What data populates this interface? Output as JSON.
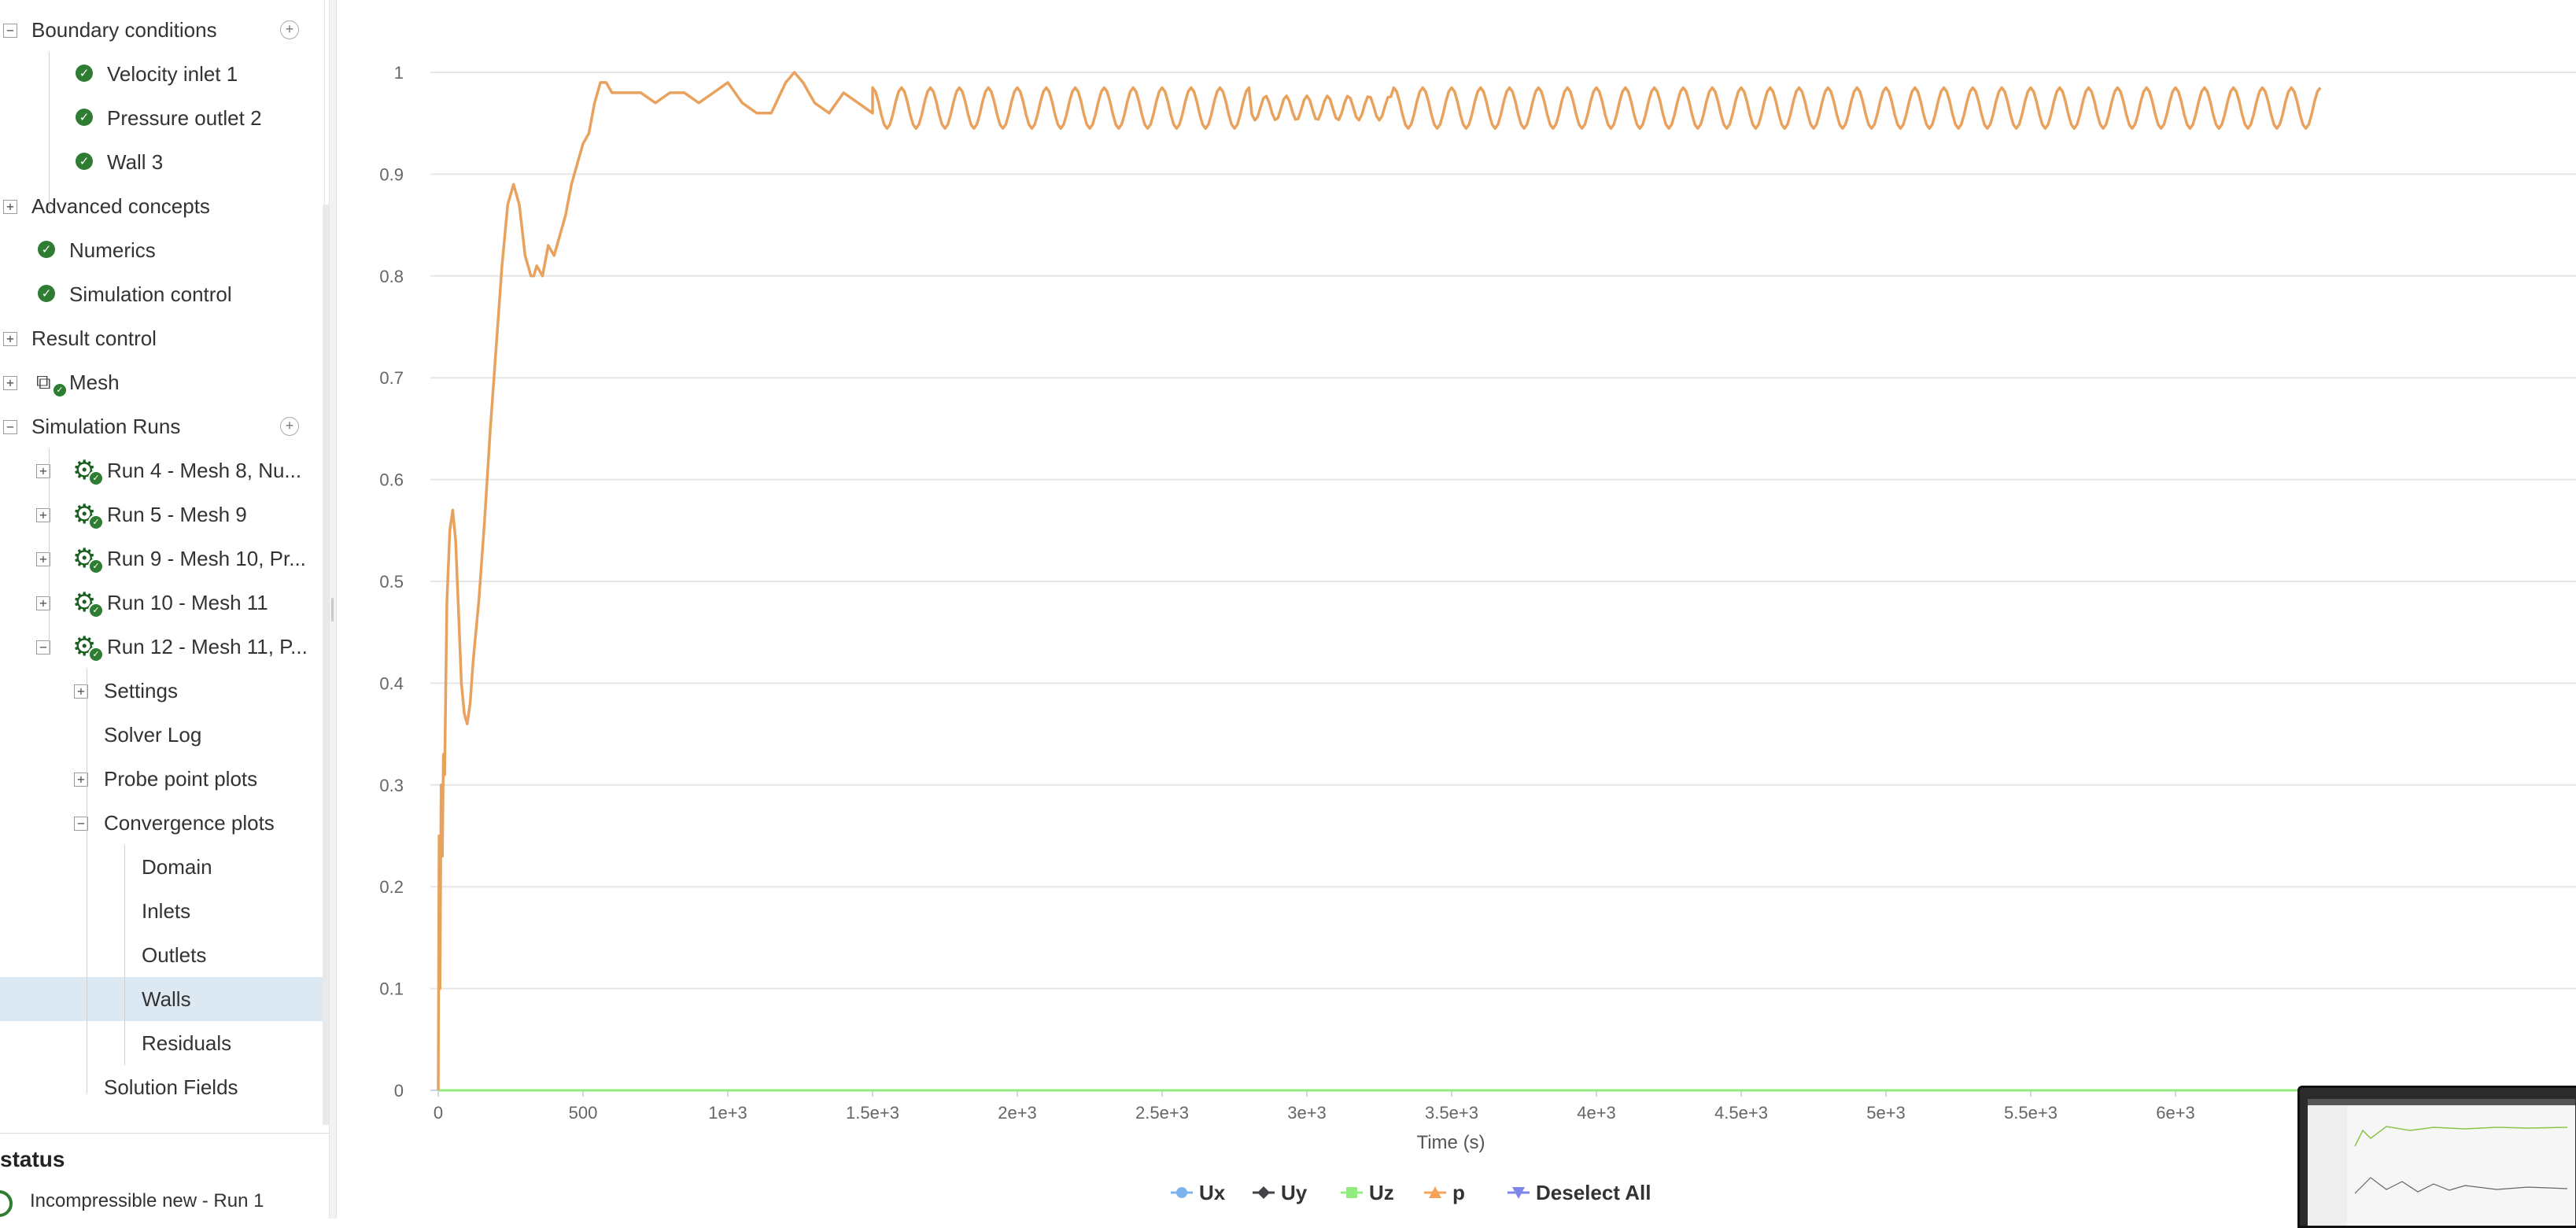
{
  "sidebar": {
    "tree": [
      {
        "label": "Boundary conditions",
        "level": 0,
        "expander": "minus",
        "add": true
      },
      {
        "label": "Velocity inlet 1",
        "level": 1,
        "icon": "check-icon"
      },
      {
        "label": "Pressure outlet 2",
        "level": 1,
        "icon": "check-icon"
      },
      {
        "label": "Wall 3",
        "level": 1,
        "icon": "check-icon"
      },
      {
        "label": "Advanced concepts",
        "level": 0,
        "expander": "plus"
      },
      {
        "label": "Numerics",
        "level": 0,
        "icon": "check-icon"
      },
      {
        "label": "Simulation control",
        "level": 0,
        "icon": "check-icon"
      },
      {
        "label": "Result control",
        "level": 0,
        "expander": "plus"
      },
      {
        "label": "Mesh",
        "level": 0,
        "expander": "plus",
        "icon": "mesh-icon"
      },
      {
        "label": "Simulation Runs",
        "level": 0,
        "expander": "minus",
        "add": true
      },
      {
        "label": "Run 4 - Mesh 8, Nu...",
        "level": 1,
        "expander": "plus",
        "icon": "gear-icon"
      },
      {
        "label": "Run 5 - Mesh 9",
        "level": 1,
        "expander": "plus",
        "icon": "gear-icon"
      },
      {
        "label": "Run 9 - Mesh 10, Pr...",
        "level": 1,
        "expander": "plus",
        "icon": "gear-icon"
      },
      {
        "label": "Run 10 - Mesh 11",
        "level": 1,
        "expander": "plus",
        "icon": "gear-icon"
      },
      {
        "label": "Run 12 - Mesh 11, P...",
        "level": 1,
        "expander": "minus",
        "icon": "gear-icon"
      },
      {
        "label": "Settings",
        "level": 2,
        "expander": "plus"
      },
      {
        "label": "Solver Log",
        "level": 2
      },
      {
        "label": "Probe point plots",
        "level": 2,
        "expander": "plus"
      },
      {
        "label": "Convergence plots",
        "level": 2,
        "expander": "minus"
      },
      {
        "label": "Domain",
        "level": 3
      },
      {
        "label": "Inlets",
        "level": 3
      },
      {
        "label": "Outlets",
        "level": 3
      },
      {
        "label": "Walls",
        "level": 3,
        "selected": true
      },
      {
        "label": "Residuals",
        "level": 3
      },
      {
        "label": "Solution Fields",
        "level": 2
      }
    ]
  },
  "status": {
    "title": "status",
    "item": "Incompressible new - Run 1"
  },
  "chart_data": {
    "type": "line",
    "xlabel": "Time (s)",
    "ylabel": "",
    "xlim": [
      0,
      7000
    ],
    "ylim": [
      0,
      1
    ],
    "x_ticks": [
      "0",
      "500",
      "1e+3",
      "1.5e+3",
      "2e+3",
      "2.5e+3",
      "3e+3",
      "3.5e+3",
      "4e+3",
      "4.5e+3",
      "5e+3",
      "5.5e+3",
      "6e+3",
      "6"
    ],
    "y_ticks": [
      "0",
      "0.1",
      "0.2",
      "0.3",
      "0.4",
      "0.5",
      "0.6",
      "0.7",
      "0.8",
      "0.9",
      "1"
    ],
    "grid": "horizontal",
    "legend_position": "bottom-center",
    "legend": [
      {
        "name": "Ux",
        "color": "#7cb5ec",
        "marker": "circle"
      },
      {
        "name": "Uy",
        "color": "#434348",
        "marker": "diamond"
      },
      {
        "name": "Uz",
        "color": "#90ed7d",
        "marker": "square"
      },
      {
        "name": "p",
        "color": "#f7a35c",
        "marker": "triangle"
      },
      {
        "name": "Deselect All",
        "color": "#8085e9",
        "marker": "triangle-down"
      }
    ],
    "series": [
      {
        "name": "p",
        "color": "#e8a25e",
        "x": [
          0,
          3,
          6,
          10,
          14,
          18,
          22,
          30,
          40,
          50,
          60,
          70,
          80,
          90,
          100,
          110,
          120,
          130,
          140,
          160,
          180,
          200,
          220,
          240,
          260,
          280,
          300,
          320,
          330,
          340,
          360,
          380,
          400,
          420,
          440,
          460,
          480,
          500,
          520,
          540,
          560,
          580,
          600,
          650,
          700,
          750,
          800,
          850,
          900,
          950,
          1000,
          1050,
          1100,
          1150,
          1200,
          1230,
          1260,
          1300,
          1350,
          1400,
          1450,
          1500
        ],
        "y": [
          0,
          0.25,
          0.1,
          0.3,
          0.23,
          0.33,
          0.31,
          0.48,
          0.55,
          0.57,
          0.54,
          0.47,
          0.4,
          0.37,
          0.36,
          0.38,
          0.42,
          0.45,
          0.48,
          0.56,
          0.65,
          0.73,
          0.81,
          0.87,
          0.89,
          0.87,
          0.82,
          0.8,
          0.8,
          0.81,
          0.8,
          0.83,
          0.82,
          0.84,
          0.86,
          0.89,
          0.91,
          0.93,
          0.94,
          0.97,
          0.99,
          0.99,
          0.98,
          0.98,
          0.98,
          0.97,
          0.98,
          0.98,
          0.97,
          0.98,
          0.99,
          0.97,
          0.96,
          0.96,
          0.99,
          1.0,
          0.99,
          0.97,
          0.96,
          0.98,
          0.97,
          0.96
        ],
        "oscillation": {
          "from": 1500,
          "to": 6500,
          "period": 100,
          "center": 0.965,
          "amplitude": 0.02
        }
      },
      {
        "name": "Ux",
        "color": "#7cb5ec",
        "x": [
          0,
          6500
        ],
        "y": [
          0,
          0
        ]
      },
      {
        "name": "Uy",
        "color": "#434348",
        "x": [
          0,
          6500
        ],
        "y": [
          0,
          0
        ]
      },
      {
        "name": "Uz",
        "color": "#90ed7d",
        "x": [
          0,
          6500
        ],
        "y": [
          0,
          0
        ]
      }
    ]
  }
}
